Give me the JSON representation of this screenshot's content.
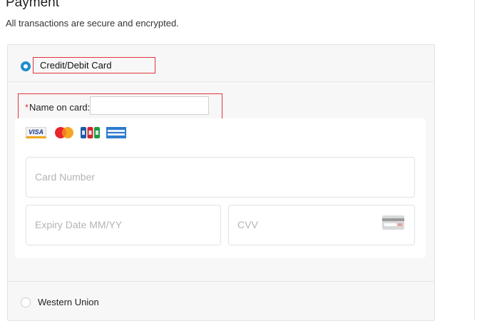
{
  "header": {
    "title": "Payment",
    "subtitle": "All transactions are secure and encrypted."
  },
  "payment_methods": [
    {
      "label": "Credit/Debit Card",
      "selected": true
    },
    {
      "label": "Western Union",
      "selected": false
    }
  ],
  "name_field": {
    "required_mark": "*",
    "label": "Name on card:",
    "value": ""
  },
  "card_logos": [
    {
      "name": "visa-logo",
      "text": "VISA"
    },
    {
      "name": "mastercard-logo",
      "text": "MasterCard"
    },
    {
      "name": "jcb-logo",
      "text": "JCB"
    },
    {
      "name": "amex-logo",
      "text": "AMERICAN EXPRESS"
    }
  ],
  "fields": {
    "card_number_placeholder": "Card Number",
    "expiry_placeholder": "Expiry Date MM/YY",
    "cvv_placeholder": "CVV"
  },
  "colors": {
    "accent": "#1f8ecd",
    "highlight": "#e0353b",
    "panel_bg": "#f7f7f7",
    "placeholder": "#b4b4b4"
  }
}
